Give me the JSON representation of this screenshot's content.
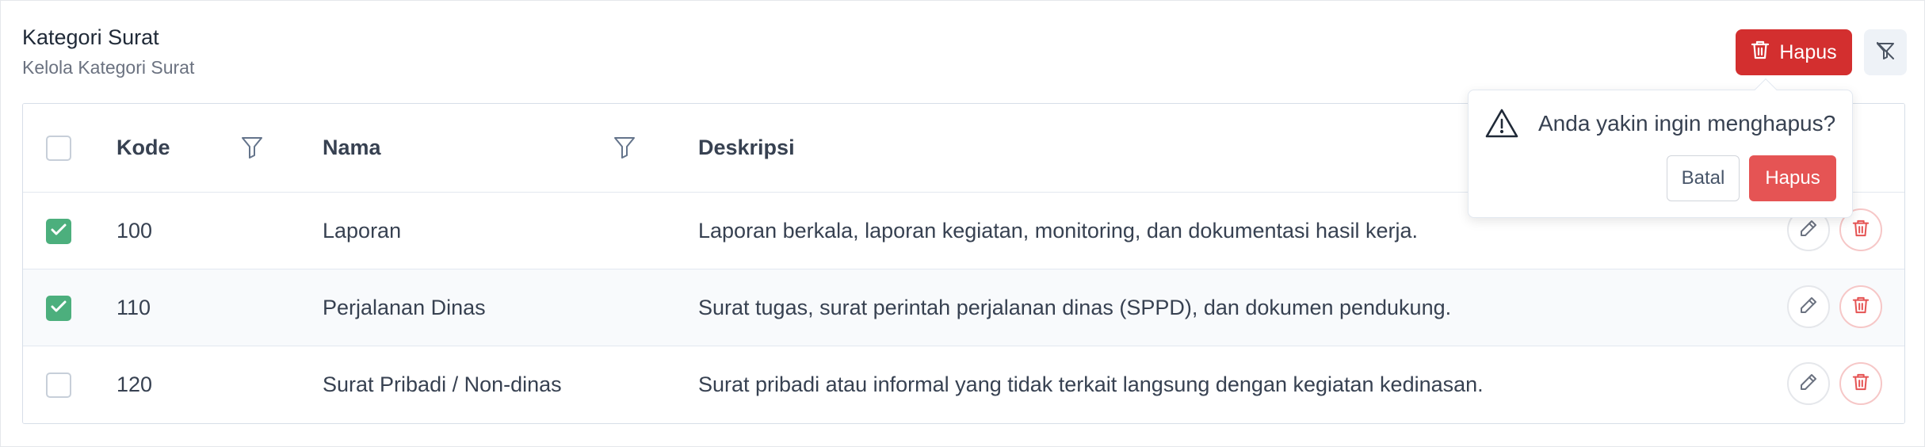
{
  "header": {
    "title": "Kategori Surat",
    "subtitle": "Kelola Kategori Surat",
    "delete_label": "Hapus"
  },
  "table": {
    "columns": [
      "Kode",
      "Nama",
      "Deskripsi"
    ],
    "rows": [
      {
        "kode": "100",
        "nama": "Laporan",
        "deskripsi": "Laporan berkala, laporan kegiatan, monitoring, dan dokumentasi hasil kerja.",
        "checked": true
      },
      {
        "kode": "110",
        "nama": "Perjalanan Dinas",
        "deskripsi": "Surat tugas, surat perintah perjalanan dinas (SPPD), dan dokumen pendukung.",
        "checked": true
      },
      {
        "kode": "120",
        "nama": "Surat Pribadi / Non-dinas",
        "deskripsi": "Surat pribadi atau informal yang tidak terkait langsung dengan kegiatan kedinasan.",
        "checked": false
      }
    ]
  },
  "popover": {
    "message": "Anda yakin ingin menghapus?",
    "cancel_label": "Batal",
    "confirm_label": "Hapus"
  },
  "icons": {
    "delete": "trash-icon",
    "clear_filter": "filter-clear-icon",
    "column_filter": "filter-icon",
    "edit": "pencil-icon",
    "warning": "warning-icon",
    "check": "check-icon"
  },
  "colors": {
    "danger": "#d32f2f",
    "danger_light": "#e55454",
    "success": "#4caf7d"
  }
}
